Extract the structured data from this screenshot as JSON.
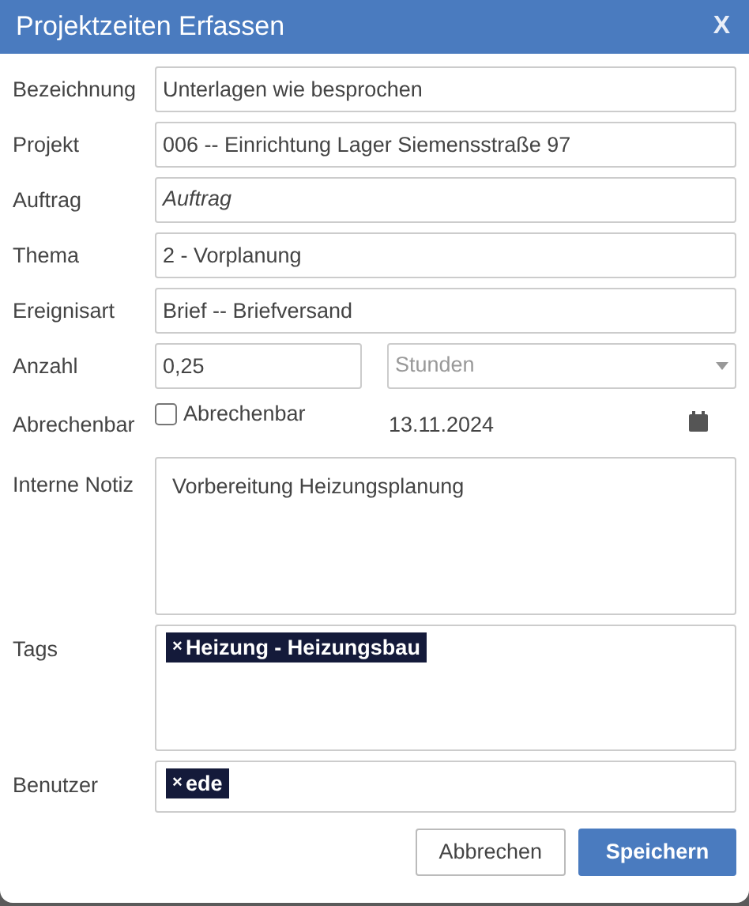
{
  "dialog": {
    "title": "Projektzeiten Erfassen",
    "close": "X"
  },
  "fields": [
    {
      "kind": "text",
      "label": "Bezeichnung",
      "value": "Unterlagen wie besprochen"
    },
    {
      "kind": "text",
      "label": "Projekt",
      "value": "006 -- Einrichtung Lager Siemensstraße 97"
    },
    {
      "kind": "text",
      "label": "Auftrag",
      "placeholder": "Auftrag"
    },
    {
      "kind": "text",
      "label": "Thema",
      "value": "2 - Vorplanung"
    },
    {
      "kind": "text",
      "label": "Ereignisart",
      "value": "Brief -- Briefversand"
    },
    {
      "kind": "amount",
      "label": "Anzahl",
      "value": "0,25",
      "unit_placeholder": "Stunden"
    },
    {
      "kind": "billable",
      "label": "Abrechenbar",
      "checkbox_label": "Abrechenbar",
      "checked": false,
      "date": "13.11.2024"
    },
    {
      "kind": "textarea",
      "label": "Interne Notiz",
      "value": "Vorbereitung Heizungsplanung"
    },
    {
      "kind": "tags",
      "label": "Tags",
      "tags": [
        {
          "remove": "×",
          "text": "Heizung - Heizungsbau"
        }
      ]
    },
    {
      "kind": "users",
      "label": "Benutzer",
      "tags": [
        {
          "remove": "×",
          "text": "ede"
        }
      ]
    }
  ],
  "buttons": [
    {
      "kind": "secondary",
      "label": "Abbrechen"
    },
    {
      "kind": "primary",
      "label": "Speichern"
    }
  ]
}
